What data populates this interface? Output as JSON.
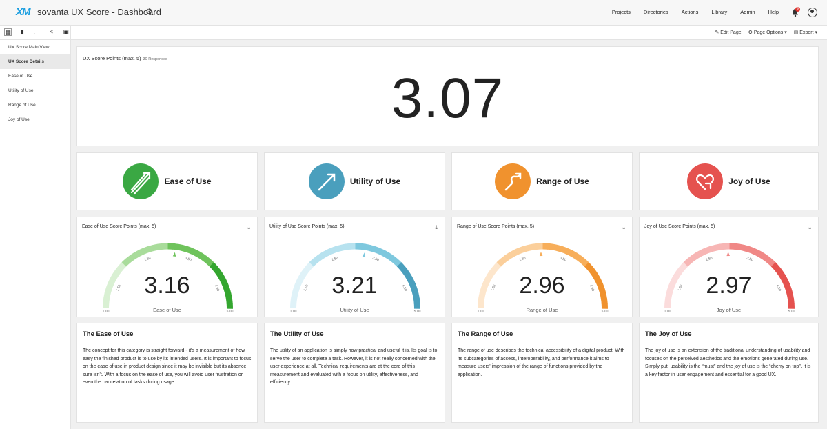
{
  "header": {
    "logo": "XM",
    "title": "sovanta UX Score  - Dashboard",
    "nav": [
      "Projects",
      "Directories",
      "Actions",
      "Library",
      "Admin",
      "Help"
    ],
    "notification_count": "9"
  },
  "toolbar": {
    "edit_page": "Edit Page",
    "page_options": "Page Options",
    "export": "Export"
  },
  "sidebar": {
    "items": [
      {
        "label": "UX Score Main View"
      },
      {
        "label": "UX Score Details"
      },
      {
        "label": "Ease of Use"
      },
      {
        "label": "Utility of Use"
      },
      {
        "label": "Range of Use"
      },
      {
        "label": "Joy of Use"
      }
    ],
    "active_index": 1
  },
  "summary": {
    "title": "UX Score Points (max. 5)",
    "responses": "30 Responses",
    "value": "3.07"
  },
  "categories": [
    {
      "label": "Ease of Use",
      "icon": "arrows-up-right-icon",
      "color": "#3aa843"
    },
    {
      "label": "Utility of Use",
      "icon": "arrow-up-right-icon",
      "color": "#4a9fbd"
    },
    {
      "label": "Range of Use",
      "icon": "squiggle-arrow-icon",
      "color": "#f0922e"
    },
    {
      "label": "Joy of Use",
      "icon": "heart-arrow-icon",
      "color": "#e5524f"
    }
  ],
  "gauges": [
    {
      "title": "Ease of Use Score Points (max. 5)",
      "value": "3.16",
      "label": "Ease of Use",
      "numeric": 3.16,
      "min": 1,
      "max": 5,
      "ticks": [
        "1.00",
        "1.50",
        "2.50",
        "3.50",
        "4.50",
        "5.00"
      ],
      "colors": [
        "#d9f0d3",
        "#a9dc9b",
        "#6fc35c",
        "#34a62f"
      ]
    },
    {
      "title": "Utility of Use Score Points (max. 5)",
      "value": "3.21",
      "label": "Utility of Use",
      "numeric": 3.21,
      "min": 1,
      "max": 5,
      "ticks": [
        "1.00",
        "1.50",
        "2.50",
        "3.50",
        "4.50",
        "5.00"
      ],
      "colors": [
        "#dff2f8",
        "#b7e2ef",
        "#7ec8de",
        "#4a9fbd"
      ]
    },
    {
      "title": "Range of Use Score Points (max. 5)",
      "value": "2.96",
      "label": "Range of Use",
      "numeric": 2.96,
      "min": 1,
      "max": 5,
      "ticks": [
        "1.00",
        "1.50",
        "2.50",
        "3.50",
        "4.50",
        "5.00"
      ],
      "colors": [
        "#fde6cc",
        "#fbcf9b",
        "#f7ae5a",
        "#f0922e"
      ]
    },
    {
      "title": "Joy of Use Score Points (max. 5)",
      "value": "2.97",
      "label": "Joy of Use",
      "numeric": 2.97,
      "min": 1,
      "max": 5,
      "ticks": [
        "1.00",
        "1.50",
        "2.50",
        "3.50",
        "4.50",
        "5.00"
      ],
      "colors": [
        "#fbdcdc",
        "#f7b6b5",
        "#f08886",
        "#e5524f"
      ]
    }
  ],
  "descriptions": [
    {
      "title": "The Ease of Use",
      "body": "The concept for this category is straight forward - it's a measurement of how easy the finished product is to use by its intended users. It is important to focus on the ease of use in product design since it may be invisible but its absence sure isn't. With a focus on the ease of use, you will avoid user frustration or even the cancelation of tasks during usage."
    },
    {
      "title": "The Utility of Use",
      "body": "The utility of an application is simply how practical and useful it is. Its goal is to serve the user to complete a task. However, it is not really concerned with the user experience at all. Technical requirements are at the core of this measurement and evaluated with a focus on utility, effectiveness, and efficiency."
    },
    {
      "title": "The Range of Use",
      "body": "The range of use describes the technical accessibility of a digital product. With its subcategories of access, interoperability, and performance it aims to measure users' impression of the range of functions provided by the application."
    },
    {
      "title": "The Joy of Use",
      "body": "The joy of use is an extension of the traditional understanding of usability and focuses on the perceived aesthetics and the emotions generated during use. Simply put, usability is the “must” and the joy of use is the “cherry on top”. It is a key factor in user engagement and essential for a good UX."
    }
  ]
}
